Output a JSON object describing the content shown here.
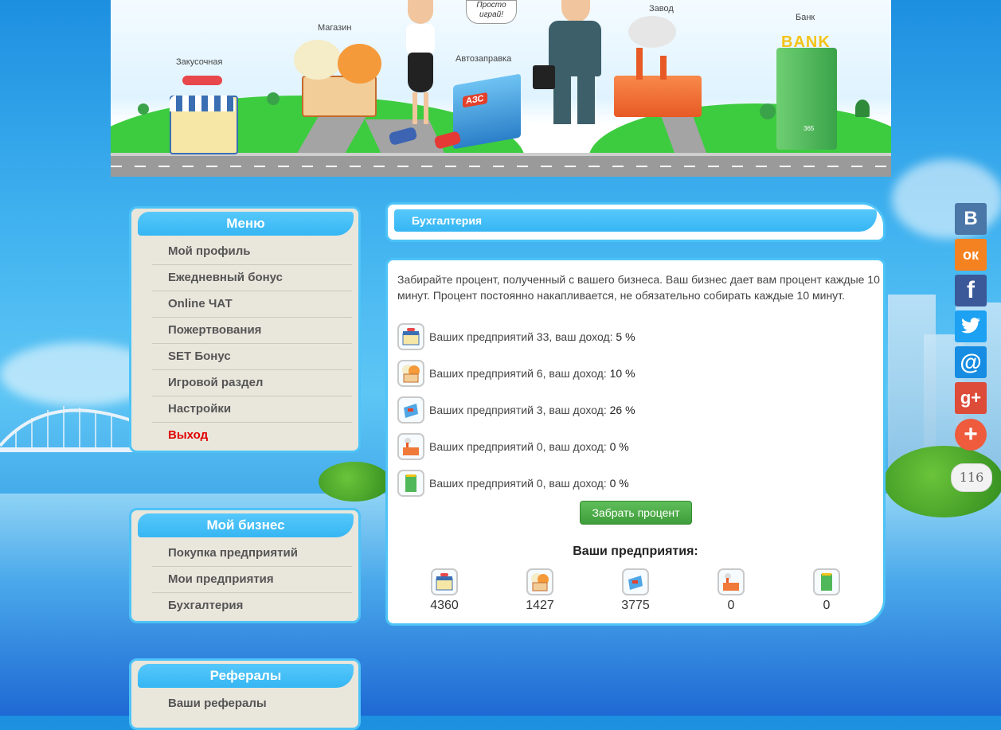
{
  "banner": {
    "labels": {
      "diner": "Закусочная",
      "shop": "Магазин",
      "gas": "Автозаправка",
      "factory": "Завод",
      "bank": "Банк"
    },
    "speech": "Просто играй!",
    "bank_sign": "BANK",
    "gas_sign": "АЗС",
    "bank_number": "365"
  },
  "menu": {
    "title": "Меню",
    "items": [
      "Мой профиль",
      "Ежедневный бонус",
      "Online ЧАТ",
      "Пожертвования",
      "SET Бонус",
      "Игровой раздел",
      "Настройки",
      "Выход"
    ]
  },
  "business": {
    "title": "Мой бизнес",
    "items": [
      "Покупка предприятий",
      "Мои предприятия",
      "Бухгалтерия"
    ]
  },
  "referrals": {
    "title": "Рефералы",
    "items": [
      "Ваши рефералы"
    ]
  },
  "page": {
    "title": "Бухгалтерия",
    "intro": "Забирайте процент, полученный с вашего бизнеса. Ваш бизнес дает вам процент каждые 10 минут. Процент постоянно накапливается, не обязательно собирать каждые 10 минут.",
    "rows": [
      {
        "prefix": "Ваших предприятий 33, ваш доход: ",
        "value": "5 %",
        "icon": "diner-icon"
      },
      {
        "prefix": "Ваших предприятий 6, ваш доход: ",
        "value": "10 %",
        "icon": "shop-icon"
      },
      {
        "prefix": "Ваших предприятий 3, ваш доход: ",
        "value": "26 %",
        "icon": "gas-station-icon"
      },
      {
        "prefix": "Ваших предприятий 0, ваш доход: ",
        "value": "0 %",
        "icon": "factory-icon"
      },
      {
        "prefix": "Ваших предприятий 0, ваш доход: ",
        "value": "0 %",
        "icon": "bank-icon"
      }
    ],
    "collect_button": "Забрать процент",
    "your_title": "Ваши предприятия:",
    "counts": [
      "4360",
      "1427",
      "3775",
      "0",
      "0"
    ]
  },
  "social": {
    "buttons": [
      {
        "name": "vk",
        "glyph": "В",
        "color": "#4a76a8"
      },
      {
        "name": "odnoklassniki",
        "glyph": "ок",
        "color": "#f58220"
      },
      {
        "name": "facebook",
        "glyph": "f",
        "color": "#3b5998"
      },
      {
        "name": "twitter",
        "glyph": "🐦",
        "color": "#1da1f2"
      },
      {
        "name": "mail",
        "glyph": "@",
        "color": "#168de2"
      },
      {
        "name": "google-plus",
        "glyph": "g+",
        "color": "#dd4b39"
      }
    ],
    "share_glyph": "+",
    "share_color": "#ee5b3d",
    "count": "116"
  },
  "colors": {
    "accent": "#4dc3f7",
    "panel": "#e9e6dc",
    "exit": "#e00000",
    "button": "#4aa845"
  }
}
